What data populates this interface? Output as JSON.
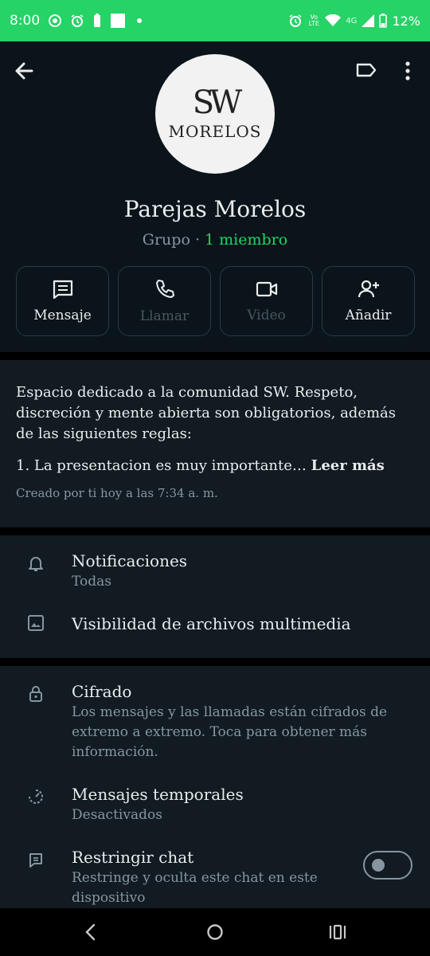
{
  "status_bar": {
    "time": "8:00",
    "network": "4G",
    "volte": "Vo LTE",
    "battery": "12%"
  },
  "header": {
    "avatar_text_top": "SW",
    "avatar_text_bottom": "MORELOS",
    "group_name": "Parejas Morelos",
    "group_type": "Grupo",
    "separator": "·",
    "member_count": "1 miembro"
  },
  "actions": [
    {
      "label": "Mensaje",
      "icon": "message-icon",
      "enabled": true
    },
    {
      "label": "Llamar",
      "icon": "phone-icon",
      "enabled": false
    },
    {
      "label": "Video",
      "icon": "video-icon",
      "enabled": false
    },
    {
      "label": "Añadir",
      "icon": "add-person-icon",
      "enabled": true
    }
  ],
  "description": {
    "text": "Espacio dedicado a la comunidad SW. Respeto, discreción y mente abierta son obligatorios, además de las siguientes reglas:",
    "rule_preview": "1. La presentacion es muy importante…",
    "read_more": "Leer más",
    "created": "Creado por ti hoy a las 7:34 a. m."
  },
  "settings": {
    "notifications": {
      "title": "Notificaciones",
      "sub": "Todas"
    },
    "media_visibility": {
      "title": "Visibilidad de archivos multimedia"
    },
    "encryption": {
      "title": "Cifrado",
      "sub": "Los mensajes y las llamadas están cifrados de extremo a extremo. Toca para obtener más información."
    },
    "disappearing": {
      "title": "Mensajes temporales",
      "sub": "Desactivados"
    },
    "chat_lock": {
      "title": "Restringir chat",
      "sub": "Restringe y oculta este chat en este dispositivo",
      "enabled": false
    }
  },
  "colors": {
    "accent": "#25d366",
    "background": "#0b141a",
    "surface": "#111b21",
    "secondary_text": "#8696a0"
  }
}
